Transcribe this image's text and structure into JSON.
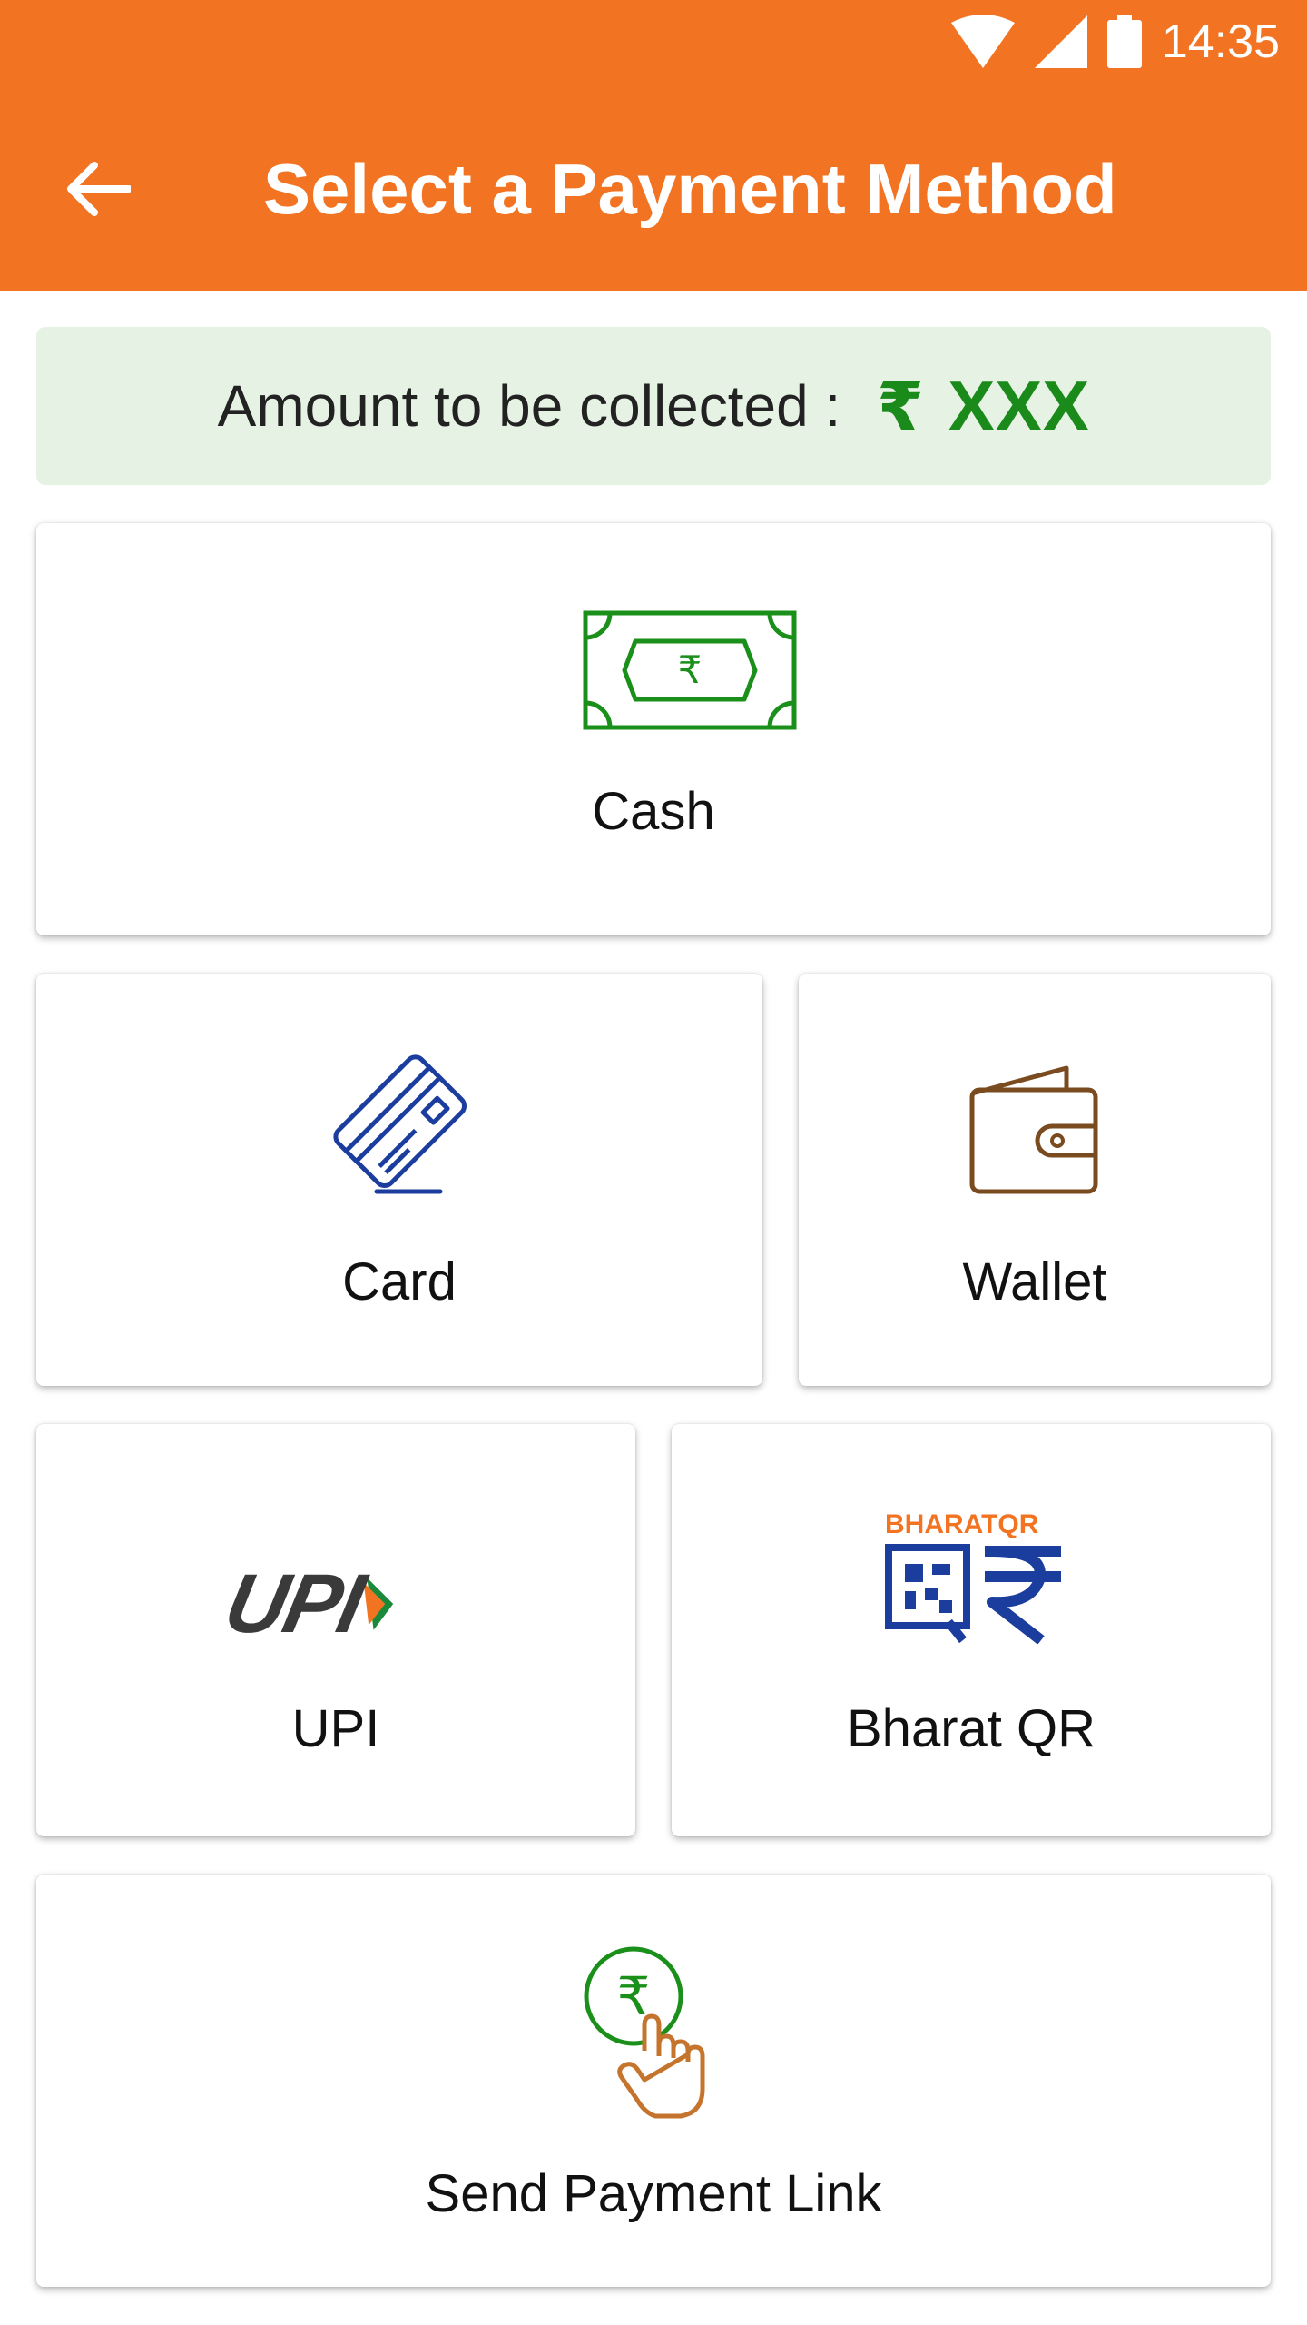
{
  "status_bar": {
    "time": "14:35"
  },
  "header": {
    "title": "Select a Payment Method"
  },
  "amount_banner": {
    "label": "Amount to be collected :",
    "currency": "₹",
    "value": "XXX"
  },
  "methods": {
    "cash": {
      "label": "Cash",
      "icon": "cash-note-icon"
    },
    "card": {
      "label": "Card",
      "icon": "credit-card-icon"
    },
    "wallet": {
      "label": "Wallet",
      "icon": "wallet-icon"
    },
    "upi": {
      "label": "UPI",
      "icon": "upi-logo",
      "logo_text": "UPI"
    },
    "bharat_qr": {
      "label": "Bharat QR",
      "icon": "bharat-qr-logo",
      "logo_text": "BHARATQR"
    },
    "payment_link": {
      "label": "Send Payment Link",
      "icon": "rupee-tap-icon"
    }
  },
  "colors": {
    "appbar": "#f27423",
    "amount_bg": "#e6f2e4",
    "amount_green": "#1a8a1a",
    "cash_green": "#1a8f1a",
    "card_blue": "#1a3d9e",
    "wallet_brown": "#7a4b1f"
  }
}
